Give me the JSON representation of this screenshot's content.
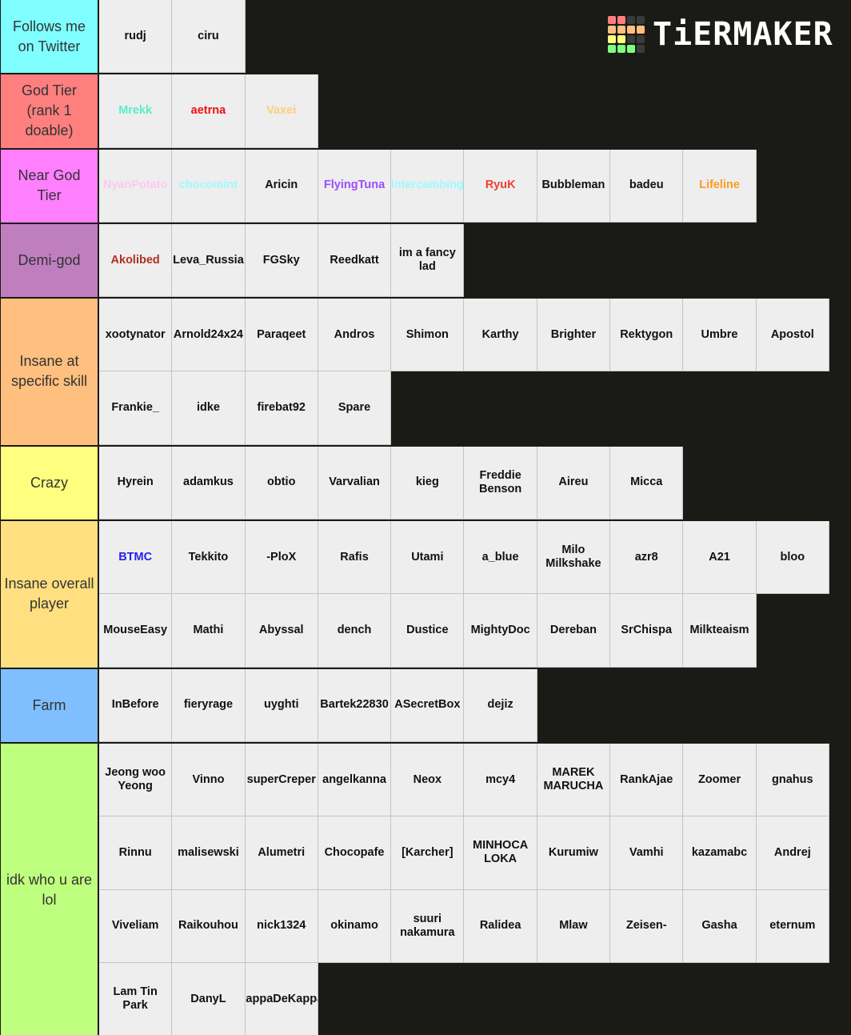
{
  "logo": {
    "text": "TiERMAKER",
    "grid_colors": [
      "#ff7f7f",
      "#ff7f7f",
      "#3a3a3a",
      "#3a3a3a",
      "#ffbf7f",
      "#ffbf7f",
      "#ffbf7f",
      "#ffbf7f",
      "#ffff7f",
      "#ffff7f",
      "#3a3a3a",
      "#3a3a3a",
      "#7fff7f",
      "#7fff7f",
      "#7fff7f",
      "#3a3a3a"
    ]
  },
  "tiers": [
    {
      "label": "Follows me on Twitter",
      "color": "#7fffff",
      "height_rows": 1,
      "items": [
        {
          "name": "rudj",
          "color": "#111111"
        },
        {
          "name": "ciru",
          "color": "#111111"
        }
      ]
    },
    {
      "label": "God Tier (rank 1 doable)",
      "color": "#ff7f7f",
      "items": [
        {
          "name": "Mrekk",
          "color": "#55f0c8"
        },
        {
          "name": "aetrna",
          "color": "#ee1111"
        },
        {
          "name": "Vaxei",
          "color": "#ffcc80"
        }
      ]
    },
    {
      "label": "Near God Tier",
      "color": "#ff7fff",
      "items": [
        {
          "name": "NyanPotato",
          "color": "#ffc8f0"
        },
        {
          "name": "chocomint",
          "color": "#a0f8ff"
        },
        {
          "name": "Aricin",
          "color": "#111111"
        },
        {
          "name": "FlyingTuna",
          "color": "#9b4dff"
        },
        {
          "name": "Intercambing",
          "color": "#a0f8ff"
        },
        {
          "name": "RyuK",
          "color": "#f04030"
        },
        {
          "name": "Bubbleman",
          "color": "#111111"
        },
        {
          "name": "badeu",
          "color": "#111111"
        },
        {
          "name": "Lifeline",
          "color": "#ff9a20"
        }
      ]
    },
    {
      "label": "Demi-god",
      "color": "#bf7fbf",
      "items": [
        {
          "name": "Akolibed",
          "color": "#b03020"
        },
        {
          "name": "Leva_Russia",
          "color": "#111111"
        },
        {
          "name": "FGSky",
          "color": "#111111"
        },
        {
          "name": "Reedkatt",
          "color": "#111111"
        },
        {
          "name": "im a fancy lad",
          "color": "#111111"
        }
      ]
    },
    {
      "label": "Insane at specific skill",
      "color": "#ffbf7f",
      "items": [
        {
          "name": "xootynator",
          "color": "#111111"
        },
        {
          "name": "Arnold24x24",
          "color": "#111111"
        },
        {
          "name": "Paraqeet",
          "color": "#111111"
        },
        {
          "name": "Andros",
          "color": "#111111"
        },
        {
          "name": "Shimon",
          "color": "#111111"
        },
        {
          "name": "Karthy",
          "color": "#111111"
        },
        {
          "name": "Brighter",
          "color": "#111111"
        },
        {
          "name": "Rektygon",
          "color": "#111111"
        },
        {
          "name": "Umbre",
          "color": "#111111"
        },
        {
          "name": "Apostol",
          "color": "#111111"
        },
        {
          "name": "Frankie_",
          "color": "#111111"
        },
        {
          "name": "idke",
          "color": "#111111"
        },
        {
          "name": "firebat92",
          "color": "#111111"
        },
        {
          "name": "Spare",
          "color": "#111111"
        }
      ]
    },
    {
      "label": "Crazy",
      "color": "#ffff7f",
      "items": [
        {
          "name": "Hyrein",
          "color": "#111111"
        },
        {
          "name": "adamkus",
          "color": "#111111"
        },
        {
          "name": "obtio",
          "color": "#111111"
        },
        {
          "name": "Varvalian",
          "color": "#111111"
        },
        {
          "name": "kieg",
          "color": "#111111"
        },
        {
          "name": "Freddie Benson",
          "color": "#111111"
        },
        {
          "name": "Aireu",
          "color": "#111111"
        },
        {
          "name": "Micca",
          "color": "#111111"
        }
      ]
    },
    {
      "label": "Insane overall player",
      "color": "#ffdf80",
      "items": [
        {
          "name": "BTMC",
          "color": "#2222ee"
        },
        {
          "name": "Tekkito",
          "color": "#111111"
        },
        {
          "name": "-PloX",
          "color": "#111111"
        },
        {
          "name": "Rafis",
          "color": "#111111"
        },
        {
          "name": "Utami",
          "color": "#111111"
        },
        {
          "name": "a_blue",
          "color": "#111111"
        },
        {
          "name": "Milo Milkshake",
          "color": "#111111"
        },
        {
          "name": "azr8",
          "color": "#111111"
        },
        {
          "name": "A21",
          "color": "#111111"
        },
        {
          "name": "bloo",
          "color": "#111111"
        },
        {
          "name": "MouseEasy",
          "color": "#111111"
        },
        {
          "name": "Mathi",
          "color": "#111111"
        },
        {
          "name": "Abyssal",
          "color": "#111111"
        },
        {
          "name": "dench",
          "color": "#111111"
        },
        {
          "name": "Dustice",
          "color": "#111111"
        },
        {
          "name": "MightyDoc",
          "color": "#111111"
        },
        {
          "name": "Dereban",
          "color": "#111111"
        },
        {
          "name": "SrChispa",
          "color": "#111111"
        },
        {
          "name": "Milkteaism",
          "color": "#111111"
        }
      ]
    },
    {
      "label": "Farm",
      "color": "#7fbfff",
      "items": [
        {
          "name": "InBefore",
          "color": "#111111"
        },
        {
          "name": "fieryrage",
          "color": "#111111"
        },
        {
          "name": "uyghti",
          "color": "#111111"
        },
        {
          "name": "Bartek22830",
          "color": "#111111"
        },
        {
          "name": "ASecretBox",
          "color": "#111111"
        },
        {
          "name": "dejiz",
          "color": "#111111"
        }
      ]
    },
    {
      "label": "idk who u are lol",
      "color": "#bfff7f",
      "items": [
        {
          "name": "Jeong woo Yeong",
          "color": "#111111"
        },
        {
          "name": "Vinno",
          "color": "#111111"
        },
        {
          "name": "superCreper",
          "color": "#111111"
        },
        {
          "name": "angelkanna",
          "color": "#111111"
        },
        {
          "name": "Neox",
          "color": "#111111"
        },
        {
          "name": "mcy4",
          "color": "#111111"
        },
        {
          "name": "MAREK MARUCHA",
          "color": "#111111"
        },
        {
          "name": "RankAjae",
          "color": "#111111"
        },
        {
          "name": "Zoomer",
          "color": "#111111"
        },
        {
          "name": "gnahus",
          "color": "#111111"
        },
        {
          "name": "Rinnu",
          "color": "#111111"
        },
        {
          "name": "malisewski",
          "color": "#111111"
        },
        {
          "name": "Alumetri",
          "color": "#111111"
        },
        {
          "name": "Chocopafe",
          "color": "#111111"
        },
        {
          "name": "[Karcher]",
          "color": "#111111"
        },
        {
          "name": "MINHOCA LOKA",
          "color": "#111111"
        },
        {
          "name": "Kurumiw",
          "color": "#111111"
        },
        {
          "name": "Vamhi",
          "color": "#111111"
        },
        {
          "name": "kazamabc",
          "color": "#111111"
        },
        {
          "name": "Andrej",
          "color": "#111111"
        },
        {
          "name": "Viveliam",
          "color": "#111111"
        },
        {
          "name": "Raikouhou",
          "color": "#111111"
        },
        {
          "name": "nick1324",
          "color": "#111111"
        },
        {
          "name": "okinamo",
          "color": "#111111"
        },
        {
          "name": "suuri nakamura",
          "color": "#111111"
        },
        {
          "name": "Ralidea",
          "color": "#111111"
        },
        {
          "name": "Mlaw",
          "color": "#111111"
        },
        {
          "name": "Zeisen-",
          "color": "#111111"
        },
        {
          "name": "Gasha",
          "color": "#111111"
        },
        {
          "name": "eternum",
          "color": "#111111"
        },
        {
          "name": "Lam Tin Park",
          "color": "#111111"
        },
        {
          "name": "DanyL",
          "color": "#111111"
        },
        {
          "name": "JappaDeKappa",
          "color": "#111111"
        }
      ]
    }
  ]
}
